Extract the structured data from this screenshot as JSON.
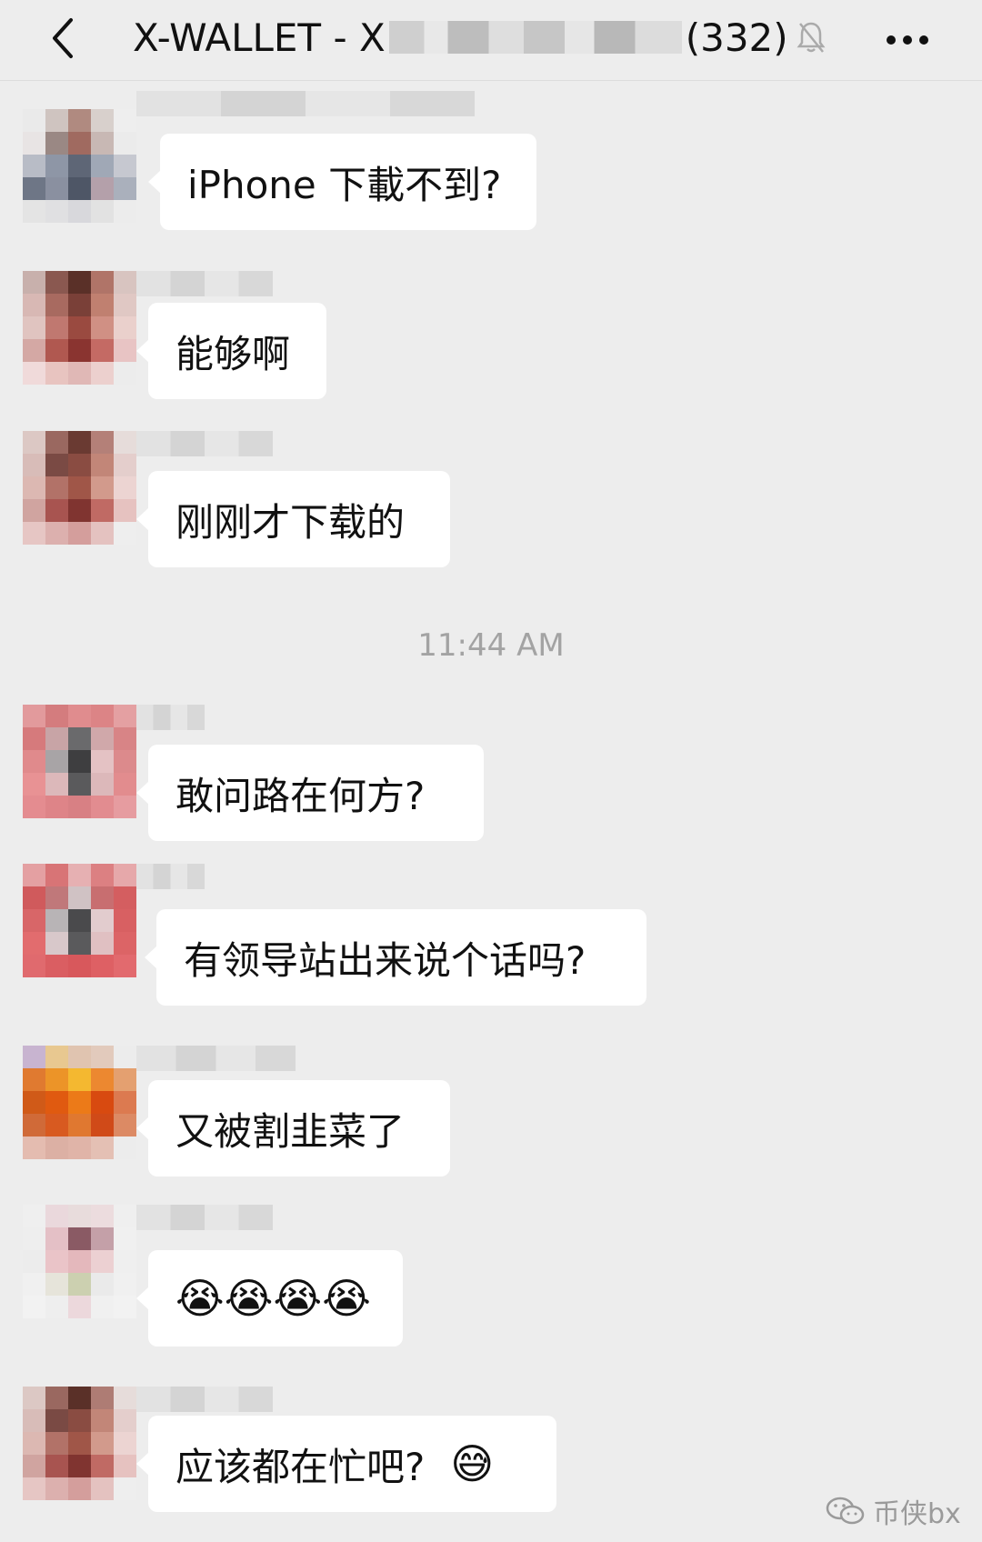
{
  "header": {
    "title_prefix": "X-WALLET - X",
    "member_count": "(332)"
  },
  "timestamp": "11:44 AM",
  "messages": [
    {
      "text": "iPhone 下載不到?"
    },
    {
      "text": "能够啊"
    },
    {
      "text": "刚刚才下载的"
    },
    {
      "text": "敢问路在何方?"
    },
    {
      "text": "有领导站出来说个话吗?"
    },
    {
      "text": "又被割韭菜了"
    },
    {
      "text": "😭😭😭😭"
    },
    {
      "text": "应该都在忙吧?",
      "emoji": "😅"
    }
  ],
  "watermark": "币侠bx",
  "icons": [
    "back-arrow-icon",
    "muted-bell-icon",
    "more-dots-icon",
    "wechat-icon"
  ]
}
